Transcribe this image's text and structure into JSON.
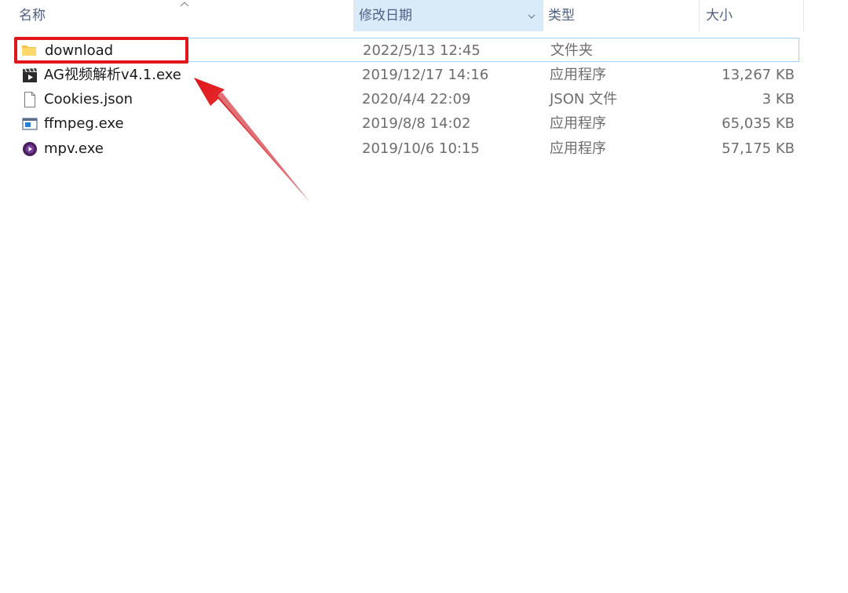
{
  "columns": {
    "name": "名称",
    "date": "修改日期",
    "type": "类型",
    "size": "大小"
  },
  "sort_indicator": "^",
  "files": [
    {
      "name": "download",
      "date": "2022/5/13 12:45",
      "type": "文件夹",
      "size": "",
      "icon": "folder-icon"
    },
    {
      "name": "AG视频解析v4.1.exe",
      "date": "2019/12/17 14:16",
      "type": "应用程序",
      "size": "13,267 KB",
      "icon": "clapperboard-app-icon"
    },
    {
      "name": "Cookies.json",
      "date": "2020/4/4 22:09",
      "type": "JSON 文件",
      "size": "3 KB",
      "icon": "blank-file-icon"
    },
    {
      "name": "ffmpeg.exe",
      "date": "2019/8/8 14:02",
      "type": "应用程序",
      "size": "65,035 KB",
      "icon": "window-app-icon"
    },
    {
      "name": "mpv.exe",
      "date": "2019/10/6 10:15",
      "type": "应用程序",
      "size": "57,175 KB",
      "icon": "mpv-player-icon"
    }
  ],
  "colors": {
    "annotation": "#e0161b",
    "sorted_header_bg": "#d9ebf9",
    "selection_border": "#99d1ff"
  }
}
